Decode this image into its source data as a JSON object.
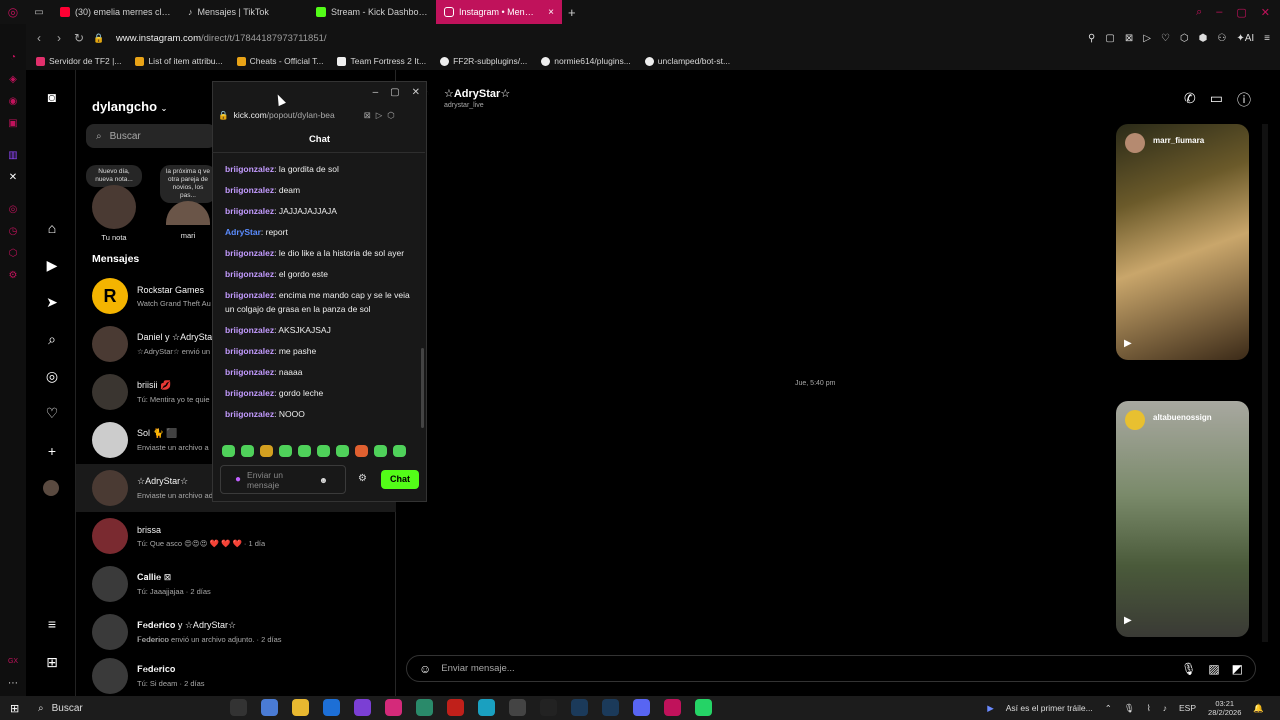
{
  "browser": {
    "tabs": [
      {
        "label": "(30) emelia mernes club h",
        "color": "#ff0033"
      },
      {
        "label": "Mensajes | TikTok",
        "color": "#ffffff"
      },
      {
        "label": "Stream - Kick Dashboard",
        "color": "#53fc18"
      },
      {
        "label": "Instagram • Mensajes",
        "color": "#ffffff",
        "active": true
      }
    ],
    "url_host": "www.instagram.com",
    "url_path": "/direct/t/17844187973711851/",
    "ai_label": "AI",
    "bookmarks": [
      {
        "label": "Servidor de TF2 |...",
        "color": "#e1306c"
      },
      {
        "label": "List of item attribu...",
        "color": "#e8a317"
      },
      {
        "label": "Cheats - Official T...",
        "color": "#e8a317"
      },
      {
        "label": "Team Fortress 2 It...",
        "color": "#eeeeee"
      },
      {
        "label": "FF2R-subplugins/...",
        "color": "#eeeeee"
      },
      {
        "label": "normie614/plugins...",
        "color": "#eeeeee"
      },
      {
        "label": "unclamped/bot-st...",
        "color": "#eeeeee"
      }
    ]
  },
  "instagram": {
    "username": "dylangcho",
    "search_placeholder": "Buscar",
    "notes": [
      {
        "bubble": "Nuevo día, nueva nota...",
        "label": "Tu nota"
      },
      {
        "bubble": "la próxima q ve otra pareja de novios, los pas...",
        "label": "mari"
      }
    ],
    "messages_heading": "Mensajes",
    "conversations": [
      {
        "name": "Rockstar Games",
        "preview": "Watch Grand Theft Au",
        "color": "#f4b400"
      },
      {
        "name": "Daniel y ☆AdryStar",
        "preview": "☆AdryStar☆ envió un",
        "color": "#4a3a33"
      },
      {
        "name": "briisii 💋",
        "preview": "Tú: Mentira yo te quie",
        "color": "#3a3530"
      },
      {
        "name": "Sol 🐈 ⬛",
        "preview": "Enviaste un archivo a",
        "color": "#cccccc"
      },
      {
        "name": "☆AdryStar☆",
        "preview": "Enviaste un archivo ad",
        "color": "#4a3a33",
        "selected": true
      },
      {
        "name": "brissa",
        "preview": "Tú: Que asco 😍😍😍 ❤️ ❤️ ❤️ · 1 día",
        "color": "#7a2a30"
      },
      {
        "name": "𝐂𝐚𝐥𝐥𝐢𝐞 ⊠",
        "preview": "Tú: Jaaajjajaa · 2 días",
        "color": "#3a3a3a"
      },
      {
        "name": "𝐅𝐞𝐝𝐞𝐫𝐢𝐜𝐨 y ☆AdryStar☆",
        "preview": "𝐅𝐞𝐝𝐞𝐫𝐢𝐜𝐨 envió un archivo adjunto. · 2 días",
        "color": "#3a3a3a"
      },
      {
        "name": "𝐅𝐞𝐝𝐞𝐫𝐢𝐜𝐨",
        "preview": "Tú: Si deam · 2 días",
        "color": "#3a3a3a"
      }
    ],
    "thread": {
      "name": "☆AdryStar☆",
      "handle": "adrystar_live",
      "date": "Jue, 5:40 pm",
      "reels": [
        {
          "user": "marr_fiumara"
        },
        {
          "user": "altabuenossign"
        }
      ],
      "composer_placeholder": "Enviar mensaje..."
    }
  },
  "kick_popup": {
    "url_host": "kick.com",
    "url_path": "/popout/dylan-bea",
    "title": "Chat",
    "messages": [
      {
        "user": "briigonzalez",
        "text": ": la gordita de sol"
      },
      {
        "user": "briigonzalez",
        "text": ": deam"
      },
      {
        "user": "briigonzalez",
        "text": ": JAJJAJAJJAJA"
      },
      {
        "user": "AdryStar",
        "text": ": report",
        "blue": true
      },
      {
        "user": "briigonzalez",
        "text": ": le dio like a la historia de sol ayer"
      },
      {
        "user": "briigonzalez",
        "text": ": el gordo este"
      },
      {
        "user": "briigonzalez",
        "text": ": encima me mando cap y se le veia un colgajo de grasa en la panza de sol"
      },
      {
        "user": "briigonzalez",
        "text": ": AKSJKAJSAJ"
      },
      {
        "user": "briigonzalez",
        "text": ": me pashe"
      },
      {
        "user": "briigonzalez",
        "text": ": naaaa"
      },
      {
        "user": "briigonzalez",
        "text": ": gordo leche"
      },
      {
        "user": "briigonzalez",
        "text": ": NOOO"
      }
    ],
    "input_placeholder": "Enviar un mensaje",
    "send_label": "Chat"
  },
  "taskbar": {
    "search_label": "Buscar",
    "media_title": "Así es el primer tráile...",
    "lang": "ESP",
    "time": "03:21",
    "date": "28/2/2026"
  }
}
